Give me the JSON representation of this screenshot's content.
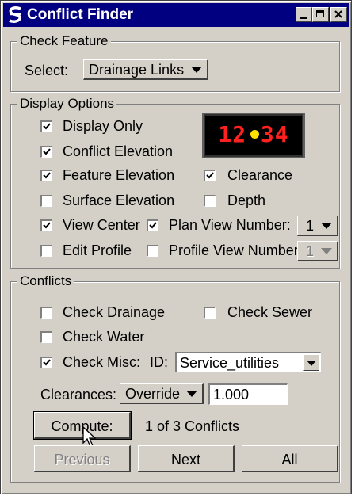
{
  "window": {
    "title": "Conflict Finder"
  },
  "check_feature": {
    "legend": "Check Feature",
    "select_label": "Select:",
    "select_value": "Drainage Links"
  },
  "display_options": {
    "legend": "Display Options",
    "clock_text": "12:34",
    "items": {
      "display_only": {
        "label": "Display Only",
        "checked": true
      },
      "conflict_elevation": {
        "label": "Conflict Elevation",
        "checked": true
      },
      "feature_elevation": {
        "label": "Feature Elevation",
        "checked": true
      },
      "clearance": {
        "label": "Clearance",
        "checked": true
      },
      "surface_elevation": {
        "label": "Surface Elevation",
        "checked": false
      },
      "depth": {
        "label": "Depth",
        "checked": false
      },
      "view_center": {
        "label": "View Center",
        "checked": true
      },
      "plan_view_number": {
        "label": "Plan View Number:",
        "checked": true,
        "value": "1"
      },
      "edit_profile": {
        "label": "Edit Profile",
        "checked": false
      },
      "profile_view_number": {
        "label": "Profile View Number:",
        "checked": false,
        "value": "1"
      }
    }
  },
  "conflicts": {
    "legend": "Conflicts",
    "check_drainage": {
      "label": "Check Drainage",
      "checked": false
    },
    "check_sewer": {
      "label": "Check Sewer",
      "checked": false
    },
    "check_water": {
      "label": "Check Water",
      "checked": false
    },
    "check_misc": {
      "label": "Check Misc:",
      "checked": true
    },
    "id_label": "ID:",
    "id_value": "Service_utilities",
    "clearances_label": "Clearances:",
    "clearances_mode": "Override",
    "clearances_value": "1.000",
    "compute_label": "Compute:",
    "conflict_status": "1 of 3 Conflicts",
    "previous_label": "Previous",
    "next_label": "Next",
    "all_label": "All"
  }
}
